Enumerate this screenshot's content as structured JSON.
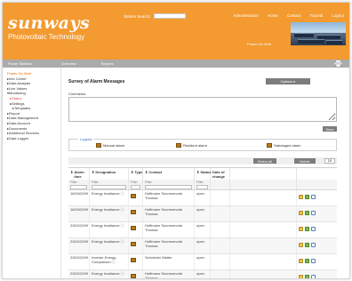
{
  "header": {
    "logo": "sunways",
    "tagline": "Photovoltaic Technology",
    "search_label": "Station Search:",
    "nav": [
      "Administration",
      "Home",
      "Contact",
      "Tutorial",
      "Logout"
    ],
    "user_link": "Power On Wolf"
  },
  "navbar": {
    "selected": "Power Stations",
    "items": [
      "Overview",
      "Reports"
    ]
  },
  "sidebar": {
    "items": [
      {
        "label": "Power On Wolf",
        "indent": 0,
        "style": "top"
      },
      {
        "label": "▸Info Center",
        "indent": 0
      },
      {
        "label": "▸Data Analysis",
        "indent": 0
      },
      {
        "label": "▸Live Values",
        "indent": 0
      },
      {
        "label": "▾Monitoring",
        "indent": 0
      },
      {
        "label": "▸Status",
        "indent": 1,
        "style": "sel"
      },
      {
        "label": "▸Settings",
        "indent": 1
      },
      {
        "label": "▸Templates",
        "indent": 2
      },
      {
        "label": "▸Report",
        "indent": 0
      },
      {
        "label": "▸Data Management",
        "indent": 0
      },
      {
        "label": "▸Data Account",
        "indent": 0
      },
      {
        "label": "▸Documents",
        "indent": 0
      },
      {
        "label": "▸Additional Services",
        "indent": 0
      },
      {
        "label": "▸Data Logger",
        "indent": 0
      }
    ]
  },
  "main": {
    "title": "Survey of Alarm Messages",
    "options_label": "Options ▸",
    "comments_label": "Comments",
    "save_label": "Save",
    "legend": {
      "title": "Legend",
      "items": [
        "Manual alarm",
        "Resident alarm",
        "Sabotaged alarm"
      ]
    },
    "toolbar": {
      "select_all": "Select all",
      "delete": "Delete",
      "per_page": "10"
    },
    "columns": [
      "Alarm time",
      "Designation",
      "Type",
      "Contact",
      "Status",
      "Date of change",
      "",
      ""
    ],
    "filter_label": "Filter",
    "rows": [
      {
        "time": "16/03/2009",
        "designation": "Energy Irradiance",
        "contact": "Hoffmann Sonnenmode Thomas",
        "status": "open"
      },
      {
        "time": "16/03/2009",
        "designation": "Energy Irradiance",
        "contact": "Hoffmann Sonnenmode Thomas",
        "status": "open"
      },
      {
        "time": "23/02/2009",
        "designation": "Energy Irradiance",
        "contact": "Hoffmann Sonnenmode Thomas",
        "status": "open"
      },
      {
        "time": "23/02/2009",
        "designation": "Energy Irradiance",
        "contact": "Hoffmann Sonnenmode Thomas",
        "status": "open"
      },
      {
        "time": "23/02/2009",
        "designation": "Inverter Energy Comparison",
        "contact": "Schneider Walter",
        "status": "open"
      },
      {
        "time": "23/02/2009",
        "designation": "Energy Irradiance",
        "contact": "Hoffmann Sonnenmode Thomas",
        "status": "open"
      }
    ]
  },
  "colors": {
    "header": "#f39a30",
    "navbar": "#ababab",
    "button": "#7d7d7d",
    "accent_red": "#d9534f"
  }
}
